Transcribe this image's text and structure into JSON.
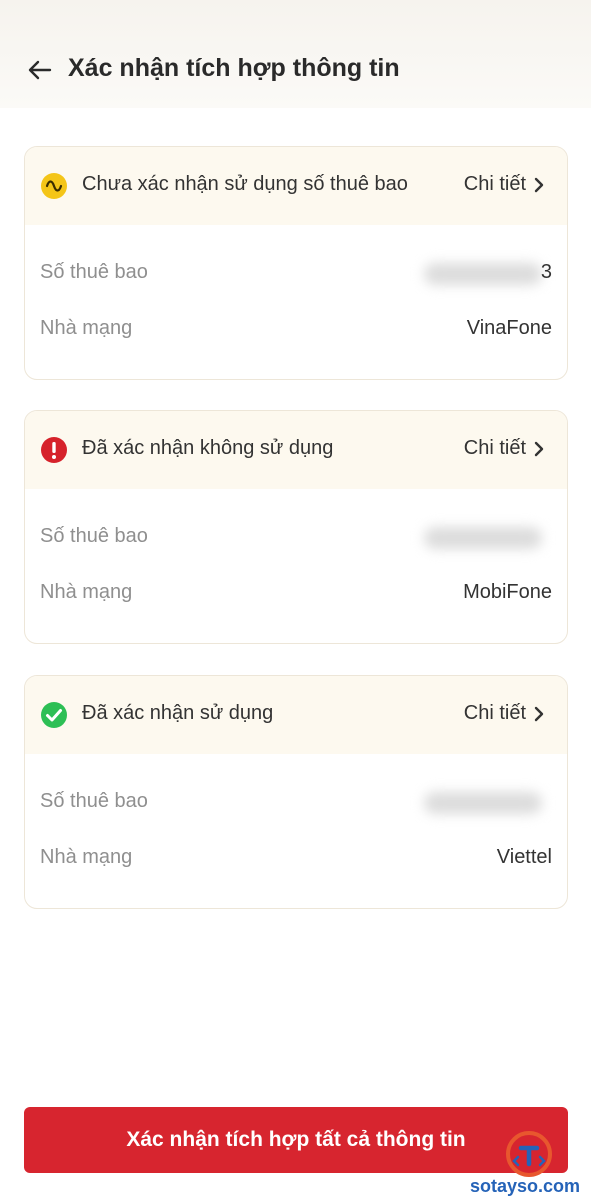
{
  "header": {
    "title": "Xác nhận tích hợp thông tin"
  },
  "colors": {
    "accent": "#d7252f",
    "pending": "#f4c518",
    "danger": "#d6222b",
    "success": "#2dbf55",
    "watermark": "#2563b8"
  },
  "cards": [
    {
      "status_icon": "pending-wave-icon",
      "status_label": "Chưa xác nhận sử dụng số thuê bao",
      "detail_label": "Chi tiết",
      "subscriber_label": "Số thuê bao",
      "subscriber_visible_tail": "3",
      "carrier_label": "Nhà mạng",
      "carrier_value": "VinaFone"
    },
    {
      "status_icon": "error-exclamation-icon",
      "status_label": "Đã xác nhận không sử dụng",
      "detail_label": "Chi tiết",
      "subscriber_label": "Số thuê bao",
      "subscriber_visible_tail": "",
      "carrier_label": "Nhà mạng",
      "carrier_value": "MobiFone"
    },
    {
      "status_icon": "check-circle-icon",
      "status_label": "Đã xác nhận sử dụng",
      "detail_label": "Chi tiết",
      "subscriber_label": "Số thuê bao",
      "subscriber_visible_tail": "",
      "carrier_label": "Nhà mạng",
      "carrier_value": "Viettel"
    }
  ],
  "footer": {
    "confirm_all_label": "Xác nhận tích hợp tất cả thông tin"
  },
  "watermark": {
    "text": "sotayso.com"
  }
}
